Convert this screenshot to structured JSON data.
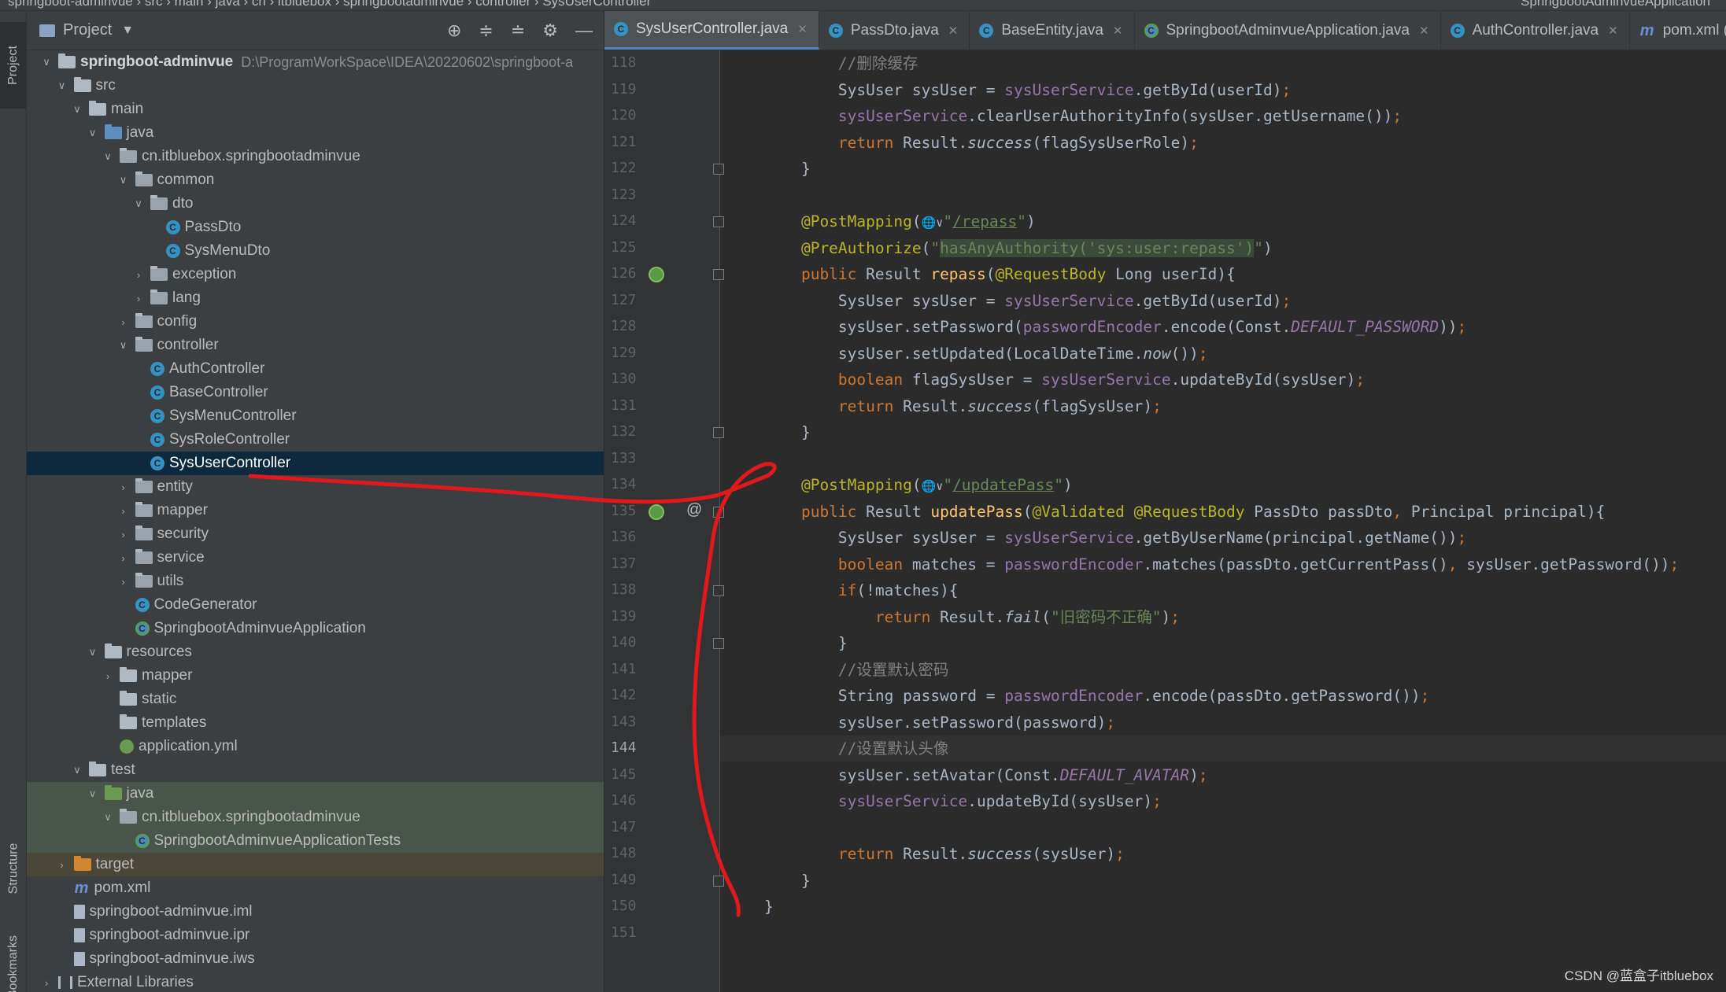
{
  "breadcrumbs": {
    "left": "springboot-adminvue  ›  src  ›  main  ›  java  ›  cn  ›  itbluebox  ›  springbootadminvue  ›  controller  ›  SysUserController",
    "right": "SpringbootAdminvueApplication"
  },
  "toolstrip": {
    "project": "Project",
    "structure": "Structure",
    "bookmarks": "Bookmarks"
  },
  "project_panel": {
    "title": "Project",
    "tree": [
      {
        "depth": 0,
        "arrow": "down",
        "icon": "folder-module",
        "label": "springboot-adminvue",
        "path": "D:\\ProgramWorkSpace\\IDEA\\20220602\\springboot-a",
        "bold": true
      },
      {
        "depth": 1,
        "arrow": "down",
        "icon": "folder",
        "label": "src"
      },
      {
        "depth": 2,
        "arrow": "down",
        "icon": "folder",
        "label": "main"
      },
      {
        "depth": 3,
        "arrow": "down",
        "icon": "folder-blue",
        "label": "java"
      },
      {
        "depth": 4,
        "arrow": "down",
        "icon": "package",
        "label": "cn.itbluebox.springbootadminvue"
      },
      {
        "depth": 5,
        "arrow": "down",
        "icon": "package",
        "label": "common"
      },
      {
        "depth": 6,
        "arrow": "down",
        "icon": "package",
        "label": "dto"
      },
      {
        "depth": 7,
        "arrow": "",
        "icon": "class",
        "label": "PassDto"
      },
      {
        "depth": 7,
        "arrow": "",
        "icon": "class",
        "label": "SysMenuDto"
      },
      {
        "depth": 6,
        "arrow": "right",
        "icon": "package",
        "label": "exception"
      },
      {
        "depth": 6,
        "arrow": "right",
        "icon": "package",
        "label": "lang"
      },
      {
        "depth": 5,
        "arrow": "right",
        "icon": "package",
        "label": "config"
      },
      {
        "depth": 5,
        "arrow": "down",
        "icon": "package",
        "label": "controller"
      },
      {
        "depth": 6,
        "arrow": "",
        "icon": "class",
        "label": "AuthController"
      },
      {
        "depth": 6,
        "arrow": "",
        "icon": "class",
        "label": "BaseController"
      },
      {
        "depth": 6,
        "arrow": "",
        "icon": "class",
        "label": "SysMenuController"
      },
      {
        "depth": 6,
        "arrow": "",
        "icon": "class",
        "label": "SysRoleController"
      },
      {
        "depth": 6,
        "arrow": "",
        "icon": "class",
        "label": "SysUserController",
        "selected": true
      },
      {
        "depth": 5,
        "arrow": "right",
        "icon": "package",
        "label": "entity"
      },
      {
        "depth": 5,
        "arrow": "right",
        "icon": "package",
        "label": "mapper"
      },
      {
        "depth": 5,
        "arrow": "right",
        "icon": "package",
        "label": "security"
      },
      {
        "depth": 5,
        "arrow": "right",
        "icon": "package",
        "label": "service"
      },
      {
        "depth": 5,
        "arrow": "right",
        "icon": "package",
        "label": "utils"
      },
      {
        "depth": 5,
        "arrow": "",
        "icon": "class",
        "label": "CodeGenerator"
      },
      {
        "depth": 5,
        "arrow": "",
        "icon": "spring-class",
        "label": "SpringbootAdminvueApplication"
      },
      {
        "depth": 3,
        "arrow": "down",
        "icon": "folder",
        "label": "resources"
      },
      {
        "depth": 4,
        "arrow": "right",
        "icon": "folder",
        "label": "mapper"
      },
      {
        "depth": 4,
        "arrow": "",
        "icon": "folder",
        "label": "static"
      },
      {
        "depth": 4,
        "arrow": "",
        "icon": "folder",
        "label": "templates"
      },
      {
        "depth": 4,
        "arrow": "",
        "icon": "yml",
        "label": "application.yml"
      },
      {
        "depth": 2,
        "arrow": "down",
        "icon": "folder",
        "label": "test"
      },
      {
        "depth": 3,
        "arrow": "down",
        "icon": "folder-green",
        "label": "java",
        "test": true
      },
      {
        "depth": 4,
        "arrow": "down",
        "icon": "package",
        "label": "cn.itbluebox.springbootadminvue",
        "test": true
      },
      {
        "depth": 5,
        "arrow": "",
        "icon": "spring-class",
        "label": "SpringbootAdminvueApplicationTests",
        "test": true
      },
      {
        "depth": 1,
        "arrow": "right",
        "icon": "folder-orange",
        "label": "target",
        "target": true
      },
      {
        "depth": 1,
        "arrow": "",
        "icon": "maven",
        "label": "pom.xml"
      },
      {
        "depth": 1,
        "arrow": "",
        "icon": "file",
        "label": "springboot-adminvue.iml"
      },
      {
        "depth": 1,
        "arrow": "",
        "icon": "file",
        "label": "springboot-adminvue.ipr"
      },
      {
        "depth": 1,
        "arrow": "",
        "icon": "file",
        "label": "springboot-adminvue.iws"
      },
      {
        "depth": 0,
        "arrow": "right",
        "icon": "library",
        "label": "External Libraries"
      }
    ]
  },
  "tabs": [
    {
      "label": "SysUserController.java",
      "icon": "class",
      "active": true
    },
    {
      "label": "PassDto.java",
      "icon": "class"
    },
    {
      "label": "BaseEntity.java",
      "icon": "class"
    },
    {
      "label": "SpringbootAdminvueApplication.java",
      "icon": "spring-class"
    },
    {
      "label": "AuthController.java",
      "icon": "class"
    },
    {
      "label": "pom.xml (s",
      "icon": "maven"
    }
  ],
  "editor": {
    "current_line": 144,
    "lines": [
      {
        "n": 118,
        "segs": [
          [
            "cmt",
            "        //删除缓存"
          ]
        ]
      },
      {
        "n": 119,
        "segs": [
          [
            "",
            "        SysUser sysUser = "
          ],
          [
            "fld",
            "sysUserService"
          ],
          [
            "",
            ".getById(userId)"
          ],
          [
            "kw",
            ";"
          ]
        ]
      },
      {
        "n": 120,
        "segs": [
          [
            "",
            "        "
          ],
          [
            "fld",
            "sysUserService"
          ],
          [
            "",
            ".clearUserAuthorityInfo(sysUser.getUsername())"
          ],
          [
            "kw",
            ";"
          ]
        ]
      },
      {
        "n": 121,
        "segs": [
          [
            "kw",
            "        return "
          ],
          [
            "",
            "Result."
          ],
          [
            "it",
            "success"
          ],
          [
            "",
            "(flagSysUserRole)"
          ],
          [
            "kw",
            ";"
          ]
        ]
      },
      {
        "n": 122,
        "segs": [
          [
            "",
            "    }"
          ]
        ],
        "fold": true
      },
      {
        "n": 123,
        "segs": [
          [
            "",
            ""
          ]
        ]
      },
      {
        "n": 124,
        "segs": [
          [
            "ann",
            "    @PostMapping"
          ],
          [
            "",
            "("
          ],
          [
            "globe",
            "🌐∨"
          ],
          [
            "str",
            "\""
          ],
          [
            "url",
            "/repass"
          ],
          [
            "str",
            "\""
          ],
          [
            "",
            ")"
          ]
        ],
        "fold": true
      },
      {
        "n": 125,
        "segs": [
          [
            "ann",
            "    @PreAuthorize"
          ],
          [
            "",
            "("
          ],
          [
            "str",
            "\""
          ],
          [
            "strhl",
            "hasAnyAuthority('sys:user:repass')"
          ],
          [
            "str",
            "\""
          ],
          [
            "",
            ")"
          ]
        ]
      },
      {
        "n": 126,
        "segs": [
          [
            "kw",
            "    public "
          ],
          [
            "",
            "Result "
          ],
          [
            "mth",
            "repass"
          ],
          [
            "",
            "("
          ],
          [
            "ann",
            "@RequestBody "
          ],
          [
            "",
            "Long userId){"
          ]
        ],
        "run": true,
        "fold": true
      },
      {
        "n": 127,
        "segs": [
          [
            "",
            "        SysUser sysUser = "
          ],
          [
            "fld",
            "sysUserService"
          ],
          [
            "",
            ".getById(userId)"
          ],
          [
            "kw",
            ";"
          ]
        ]
      },
      {
        "n": 128,
        "segs": [
          [
            "",
            "        sysUser.setPassword("
          ],
          [
            "fld",
            "passwordEncoder"
          ],
          [
            "",
            ".encode(Const."
          ],
          [
            "cst",
            "DEFAULT_PASSWORD"
          ],
          [
            "",
            "))"
          ],
          [
            "kw",
            ";"
          ]
        ]
      },
      {
        "n": 129,
        "segs": [
          [
            "",
            "        sysUser.setUpdated(LocalDateTime."
          ],
          [
            "it",
            "now"
          ],
          [
            "",
            "())"
          ],
          [
            "kw",
            ";"
          ]
        ]
      },
      {
        "n": 130,
        "segs": [
          [
            "kw",
            "        boolean "
          ],
          [
            "",
            "flagSysUser = "
          ],
          [
            "fld",
            "sysUserService"
          ],
          [
            "",
            ".updateById(sysUser)"
          ],
          [
            "kw",
            ";"
          ]
        ]
      },
      {
        "n": 131,
        "segs": [
          [
            "kw",
            "        return "
          ],
          [
            "",
            "Result."
          ],
          [
            "it",
            "success"
          ],
          [
            "",
            "(flagSysUser)"
          ],
          [
            "kw",
            ";"
          ]
        ]
      },
      {
        "n": 132,
        "segs": [
          [
            "",
            "    }"
          ]
        ],
        "fold": true
      },
      {
        "n": 133,
        "segs": [
          [
            "",
            ""
          ]
        ]
      },
      {
        "n": 134,
        "segs": [
          [
            "ann",
            "    @PostMapping"
          ],
          [
            "",
            "("
          ],
          [
            "globe",
            "🌐∨"
          ],
          [
            "str",
            "\""
          ],
          [
            "url",
            "/updatePass"
          ],
          [
            "str",
            "\""
          ],
          [
            "",
            ")"
          ]
        ]
      },
      {
        "n": 135,
        "segs": [
          [
            "kw",
            "    public "
          ],
          [
            "",
            "Result "
          ],
          [
            "mth",
            "updatePass"
          ],
          [
            "",
            "("
          ],
          [
            "ann",
            "@Validated @RequestBody "
          ],
          [
            "",
            "PassDto passDto"
          ],
          [
            "kw",
            ", "
          ],
          [
            "",
            "Principal principal){"
          ]
        ],
        "run": true,
        "at": true,
        "fold": true
      },
      {
        "n": 136,
        "segs": [
          [
            "",
            "        SysUser sysUser = "
          ],
          [
            "fld",
            "sysUserService"
          ],
          [
            "",
            ".getByUserName(principal.getName())"
          ],
          [
            "kw",
            ";"
          ]
        ]
      },
      {
        "n": 137,
        "segs": [
          [
            "kw",
            "        boolean "
          ],
          [
            "",
            "matches = "
          ],
          [
            "fld",
            "passwordEncoder"
          ],
          [
            "",
            ".matches(passDto.getCurrentPass()"
          ],
          [
            "kw",
            ", "
          ],
          [
            "",
            "sysUser.getPassword())"
          ],
          [
            "kw",
            ";"
          ]
        ]
      },
      {
        "n": 138,
        "segs": [
          [
            "kw",
            "        if"
          ],
          [
            "",
            "(!matches){"
          ]
        ],
        "fold": true
      },
      {
        "n": 139,
        "segs": [
          [
            "kw",
            "            return "
          ],
          [
            "",
            "Result."
          ],
          [
            "it",
            "fail"
          ],
          [
            "",
            "("
          ],
          [
            "str",
            "\"旧密码不正确\""
          ],
          [
            "",
            ")"
          ],
          [
            "kw",
            ";"
          ]
        ]
      },
      {
        "n": 140,
        "segs": [
          [
            "",
            "        }"
          ]
        ],
        "fold": true
      },
      {
        "n": 141,
        "segs": [
          [
            "cmt",
            "        //设置默认密码"
          ]
        ]
      },
      {
        "n": 142,
        "segs": [
          [
            "",
            "        String password = "
          ],
          [
            "fld",
            "passwordEncoder"
          ],
          [
            "",
            ".encode(passDto.getPassword())"
          ],
          [
            "kw",
            ";"
          ]
        ]
      },
      {
        "n": 143,
        "segs": [
          [
            "",
            "        sysUser.setPassword(password)"
          ],
          [
            "kw",
            ";"
          ]
        ]
      },
      {
        "n": 144,
        "segs": [
          [
            "cmt",
            "        //设置默认头像"
          ]
        ]
      },
      {
        "n": 145,
        "segs": [
          [
            "",
            "        sysUser.setAvatar(Const."
          ],
          [
            "cst",
            "DEFAULT_AVATAR"
          ],
          [
            "",
            ")"
          ],
          [
            "kw",
            ";"
          ]
        ]
      },
      {
        "n": 146,
        "segs": [
          [
            "",
            "        "
          ],
          [
            "fld",
            "sysUserService"
          ],
          [
            "",
            ".updateById(sysUser)"
          ],
          [
            "kw",
            ";"
          ]
        ]
      },
      {
        "n": 147,
        "segs": [
          [
            "",
            ""
          ]
        ]
      },
      {
        "n": 148,
        "segs": [
          [
            "kw",
            "        return "
          ],
          [
            "",
            "Result."
          ],
          [
            "it",
            "success"
          ],
          [
            "",
            "(sysUser)"
          ],
          [
            "kw",
            ";"
          ]
        ]
      },
      {
        "n": 149,
        "segs": [
          [
            "",
            "    }"
          ]
        ],
        "fold": true
      },
      {
        "n": 150,
        "segs": [
          [
            "",
            "}"
          ]
        ]
      },
      {
        "n": 151,
        "segs": [
          [
            "",
            ""
          ]
        ]
      }
    ]
  },
  "watermark": "CSDN @蓝盒子itbluebox",
  "colors": {
    "annotation_stroke": "#e0191d",
    "selection": "#0d293e",
    "tab_underline": "#4a88c7"
  }
}
